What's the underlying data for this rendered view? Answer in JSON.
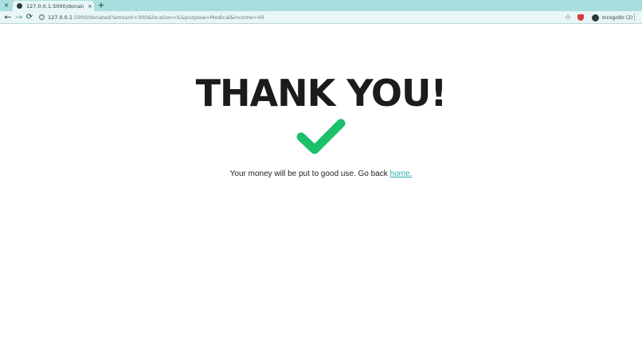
{
  "browser": {
    "tab": {
      "title": "127.0.0.1:5000/donated?amou",
      "close_symbol": "×"
    },
    "inactive_tab_close": "×",
    "new_tab_symbol": "+",
    "nav": {
      "back": "←",
      "forward": "→",
      "reload": "⟳"
    },
    "url": {
      "host": "127.0.0.1",
      "path": ":5000/donated?amount=300&location=IL&purpose=Medical&income=40"
    },
    "info_symbol": "i",
    "star_symbol": "☆",
    "incognito_label": "Incognito (2)",
    "menu_symbol": "⋮",
    "icons": {
      "favicon": "globe-icon",
      "shield": "shield-icon",
      "incognito": "incognito-icon"
    }
  },
  "page": {
    "heading": "THANK YOU!",
    "message": "Your money will be put to good use. Go back ",
    "link_text": "home.",
    "check_color": "#1cc06b",
    "link_color": "#2ab0a8"
  }
}
